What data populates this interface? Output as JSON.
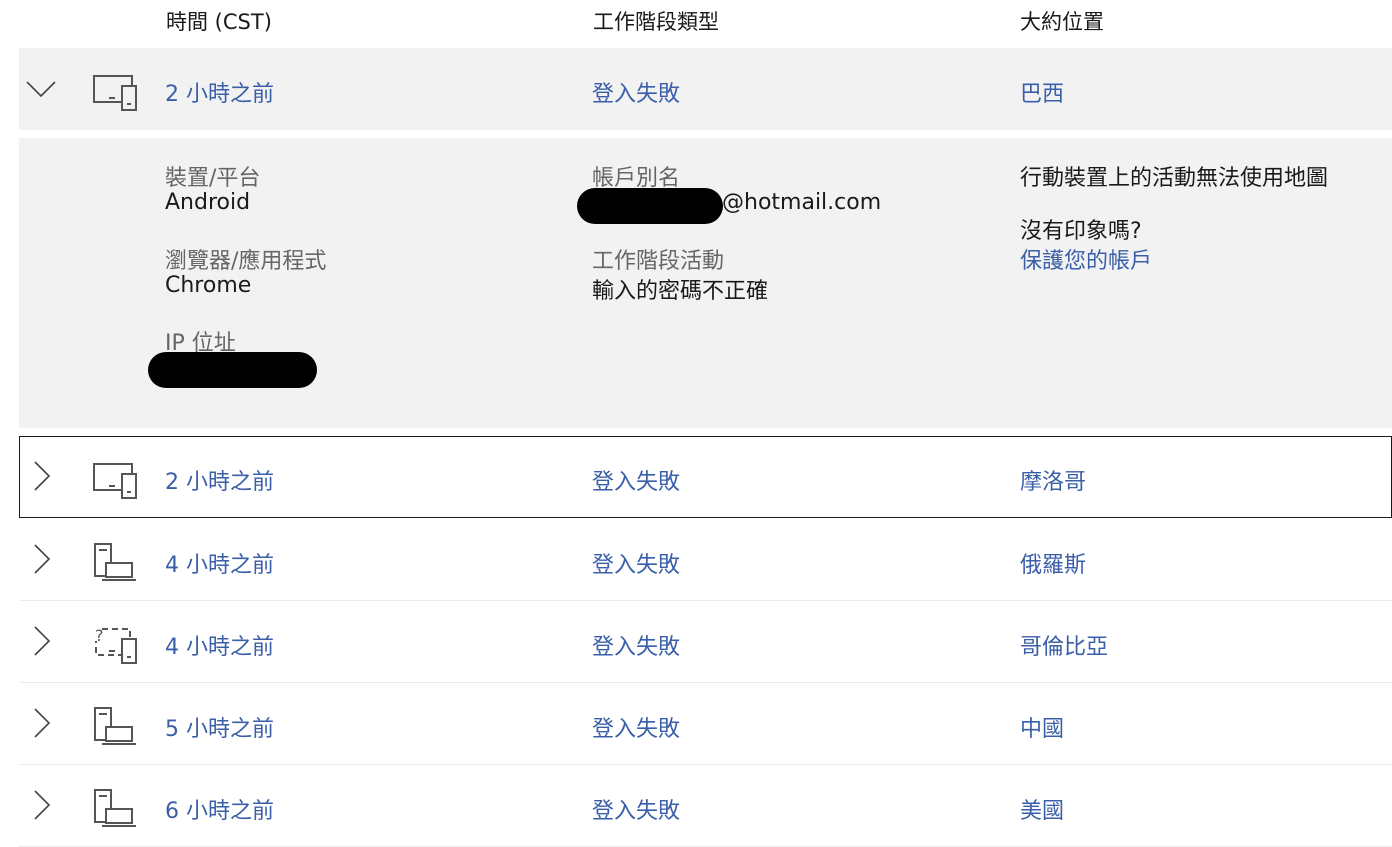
{
  "header": {
    "time_label": "時間 (CST)",
    "type_label": "工作階段類型",
    "location_label": "大約位置"
  },
  "rows": [
    {
      "time": "2 小時之前",
      "type": "登入失敗",
      "location": "巴西",
      "device_icon": "phone-tablet-icon",
      "expanded": true
    },
    {
      "time": "2 小時之前",
      "type": "登入失敗",
      "location": "摩洛哥",
      "device_icon": "phone-tablet-icon",
      "focused": true
    },
    {
      "time": "4 小時之前",
      "type": "登入失敗",
      "location": "俄羅斯",
      "device_icon": "desktop-laptop-icon"
    },
    {
      "time": "4 小時之前",
      "type": "登入失敗",
      "location": "哥倫比亞",
      "device_icon": "unknown-device-icon"
    },
    {
      "time": "5 小時之前",
      "type": "登入失敗",
      "location": "中國",
      "device_icon": "desktop-laptop-icon"
    },
    {
      "time": "6 小時之前",
      "type": "登入失敗",
      "location": "美國",
      "device_icon": "desktop-laptop-icon"
    }
  ],
  "details": {
    "device_label": "裝置/平台",
    "device_value": "Android",
    "browser_label": "瀏覽器/應用程式",
    "browser_value": "Chrome",
    "ip_label": "IP 位址",
    "alias_label": "帳戶別名",
    "alias_value_suffix": "@hotmail.com",
    "activity_label": "工作階段活動",
    "activity_value": "輸入的密碼不正確",
    "map_note": "行動裝置上的活動無法使用地圖",
    "not_recognized": "沒有印象嗎?",
    "secure_link": "保護您的帳戶"
  },
  "colors": {
    "link": "#3a5fa8",
    "expanded_bg": "#f2f2f2",
    "label_gray": "#666666"
  }
}
